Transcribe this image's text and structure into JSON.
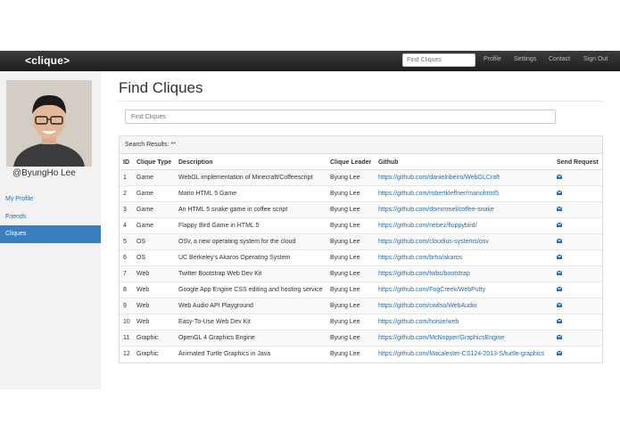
{
  "navbar": {
    "brand": "<clique>",
    "search_placeholder": "Find Cliques",
    "links": [
      "Profile",
      "Settings",
      "Contact",
      "Sign Out"
    ]
  },
  "sidebar": {
    "username": "@ByungHo Lee",
    "items": [
      {
        "label": "My Profile",
        "active": false
      },
      {
        "label": "Friends",
        "active": false
      },
      {
        "label": "Cliques",
        "active": true
      }
    ]
  },
  "main": {
    "title": "Find Cliques",
    "search_placeholder": "Find Cliques",
    "results_heading": "Search Results: **",
    "columns": [
      "ID",
      "Clique Type",
      "Description",
      "Clique Leader",
      "Github",
      "Send Request"
    ],
    "rows": [
      {
        "id": "1",
        "type": "Game",
        "description": "WebGL implementation of Minecraft/Coffeescript",
        "leader": "Byung Lee",
        "github": "https://github.com/danielribeiro/WebGLCraft"
      },
      {
        "id": "2",
        "type": "Game",
        "description": "Mario HTML 5 Game",
        "leader": "Byung Lee",
        "github": "https://github.com/robertkleffner/mariohtml5"
      },
      {
        "id": "3",
        "type": "Game",
        "description": "An HTML 5 snake game in coffee script",
        "leader": "Byung Lee",
        "github": "https://github.com/dommmel/coffee-snake"
      },
      {
        "id": "4",
        "type": "Game",
        "description": "Flappy Bird Game in HTML 5",
        "leader": "Byung Lee",
        "github": "https://github.com/nebez/floppybird/"
      },
      {
        "id": "5",
        "type": "OS",
        "description": "OSv, a new operating system for the cloud",
        "leader": "Byung Lee",
        "github": "https://github.com/cloudius-systems/osv"
      },
      {
        "id": "6",
        "type": "OS",
        "description": "UC Berkeley's Akaros Operating System",
        "leader": "Byung Lee",
        "github": "https://github.com/brho/akaros"
      },
      {
        "id": "7",
        "type": "Web",
        "description": "Twitter Bootstrap Web Dev Kit",
        "leader": "Byung Lee",
        "github": "https://github.com/twbs/bootstrap"
      },
      {
        "id": "8",
        "type": "Web",
        "description": "Google App Engine CSS editing and hosting service",
        "leader": "Byung Lee",
        "github": "https://github.com/FogCreek/WebPutty"
      },
      {
        "id": "9",
        "type": "Web",
        "description": "Web Audio API Playground",
        "leader": "Byung Lee",
        "github": "https://github.com/cwilso/WebAudio"
      },
      {
        "id": "10",
        "type": "Web",
        "description": "Easy-To-Use Web Dev Kit",
        "leader": "Byung Lee",
        "github": "https://github.com/hoisie/web"
      },
      {
        "id": "11",
        "type": "Graphic",
        "description": "OpenGL 4 Graphics Engine",
        "leader": "Byung Lee",
        "github": "https://github.com/McNopper/GraphicsEngine"
      },
      {
        "id": "12",
        "type": "Graphic",
        "description": "Animated Turtle Graphics in Java",
        "leader": "Byung Lee",
        "github": "https://github.com/Macalester-CS124-2013-S/turtle-graphics"
      }
    ]
  },
  "icons": {
    "send_request": "envelope-icon"
  },
  "colors": {
    "link": "#2a6cb0",
    "active_item": "#3a7fc1",
    "navbar": "#2b2b2b"
  }
}
